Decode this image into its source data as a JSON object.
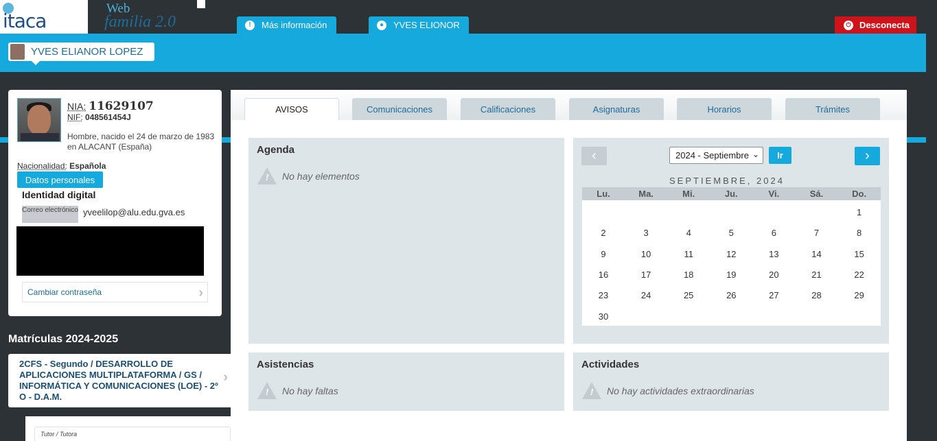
{
  "header": {
    "logo_text": "itaca",
    "web_title": "Web",
    "web_subtitle": "familia 2.0",
    "info_button": "Más información",
    "user_button": "YVES ELIONOR",
    "disconnect_button": "Desconecta"
  },
  "student": {
    "name": "YVES ELIANOR LOPEZ",
    "nia_label": "NIA:",
    "nia": "11629107",
    "nif_label": "NIF:",
    "nif": "048561454J",
    "born": "Hombre, nacido el 24 de marzo de 1983 en ALACANT (España)",
    "nac_label": "Nacionalidad:",
    "nacionalidad": "Española",
    "datos_button": "Datos personales",
    "identidad_title": "Identidad digital",
    "correo_label": "Correo electrónico",
    "correo": "yveelilop@alu.edu.gva.es",
    "cambiar": "Cambiar contraseña"
  },
  "matriculas": {
    "title": "Matrículas 2024-2025",
    "course": "2CFS - Segundo / DESARROLLO DE APLICACIONES MULTIPLATAFORMA / GS / INFORMÁTICA Y COMUNICACIONES (LOE) - 2º O - D.A.M.",
    "tutor_label": "Tutor / Tutora"
  },
  "tabs": [
    "AVISOS",
    "Comunicaciones",
    "Calificaciones",
    "Asignaturas",
    "Horarios",
    "Trámites"
  ],
  "agenda": {
    "title": "Agenda",
    "empty": "No hay elementos"
  },
  "asistencias": {
    "title": "Asistencias",
    "empty": "No hay faltas"
  },
  "actividades": {
    "title": "Actividades",
    "empty": "No hay actividades extraordinarias"
  },
  "calendar": {
    "selected": "2024 - Septiembre",
    "go": "Ir",
    "month_label": "SEPTIEMBRE, 2024",
    "weekdays": [
      "Lu.",
      "Ma.",
      "Mi.",
      "Ju.",
      "Vi.",
      "Sá.",
      "Do."
    ],
    "first_weekday_index": 6,
    "days_in_month": 30
  },
  "colors": {
    "accent": "#15a9de",
    "dark": "#2d3237",
    "danger": "#d0121b"
  }
}
